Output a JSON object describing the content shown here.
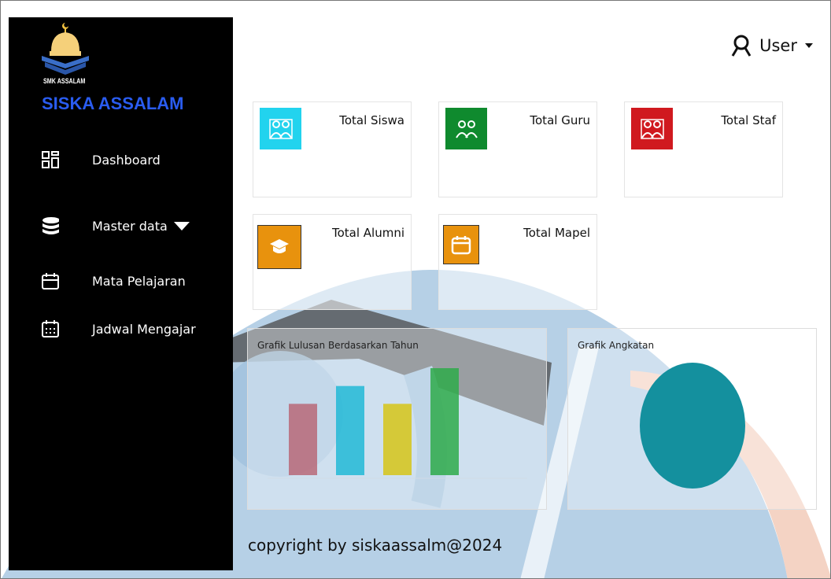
{
  "app": {
    "logo_text": "SMK ASSALAM",
    "brand": "SISKA ASSALAM"
  },
  "sidebar": {
    "items": [
      {
        "label": "Dashboard",
        "icon": "grid-icon"
      },
      {
        "label": "Master data",
        "icon": "database-icon"
      },
      {
        "label": "Mata Pelajaran",
        "icon": "calendar-icon"
      },
      {
        "label": "Jadwal Mengajar",
        "icon": "calendar-grid-icon"
      }
    ]
  },
  "header": {
    "user_label": "User"
  },
  "cards": [
    {
      "label": "Total Siswa",
      "color": "#22d3ee",
      "icon": "users-icon"
    },
    {
      "label": "Total Guru",
      "color": "#0f8a2e",
      "icon": "users-icon"
    },
    {
      "label": "Total Staf",
      "color": "#d0191f",
      "icon": "users-icon"
    },
    {
      "label": "Total Alumni",
      "color": "#e8920d",
      "icon": "graduation-cap-icon"
    },
    {
      "label": "Total Mapel",
      "color": "#e8920d",
      "icon": "calendar-icon"
    }
  ],
  "panels": {
    "left_title": "Grafik Lulusan Berdasarkan Tahun",
    "right_title": "Grafik Angkatan"
  },
  "chart_data": [
    {
      "type": "bar",
      "title": "Grafik Lulusan Berdasarkan Tahun",
      "categories": [
        "",
        "",
        "",
        ""
      ],
      "values": [
        2,
        2.5,
        2,
        3
      ],
      "colors": [
        "#b86878",
        "#22b8d6",
        "#d6c418",
        "#2eaa4a"
      ],
      "ylim": [
        0,
        3
      ]
    },
    {
      "type": "pie",
      "title": "Grafik Angkatan",
      "values": [
        1
      ],
      "colors": [
        "#14909e"
      ]
    }
  ],
  "footer": {
    "copyright": "copyright by siskaassalm@2024"
  }
}
